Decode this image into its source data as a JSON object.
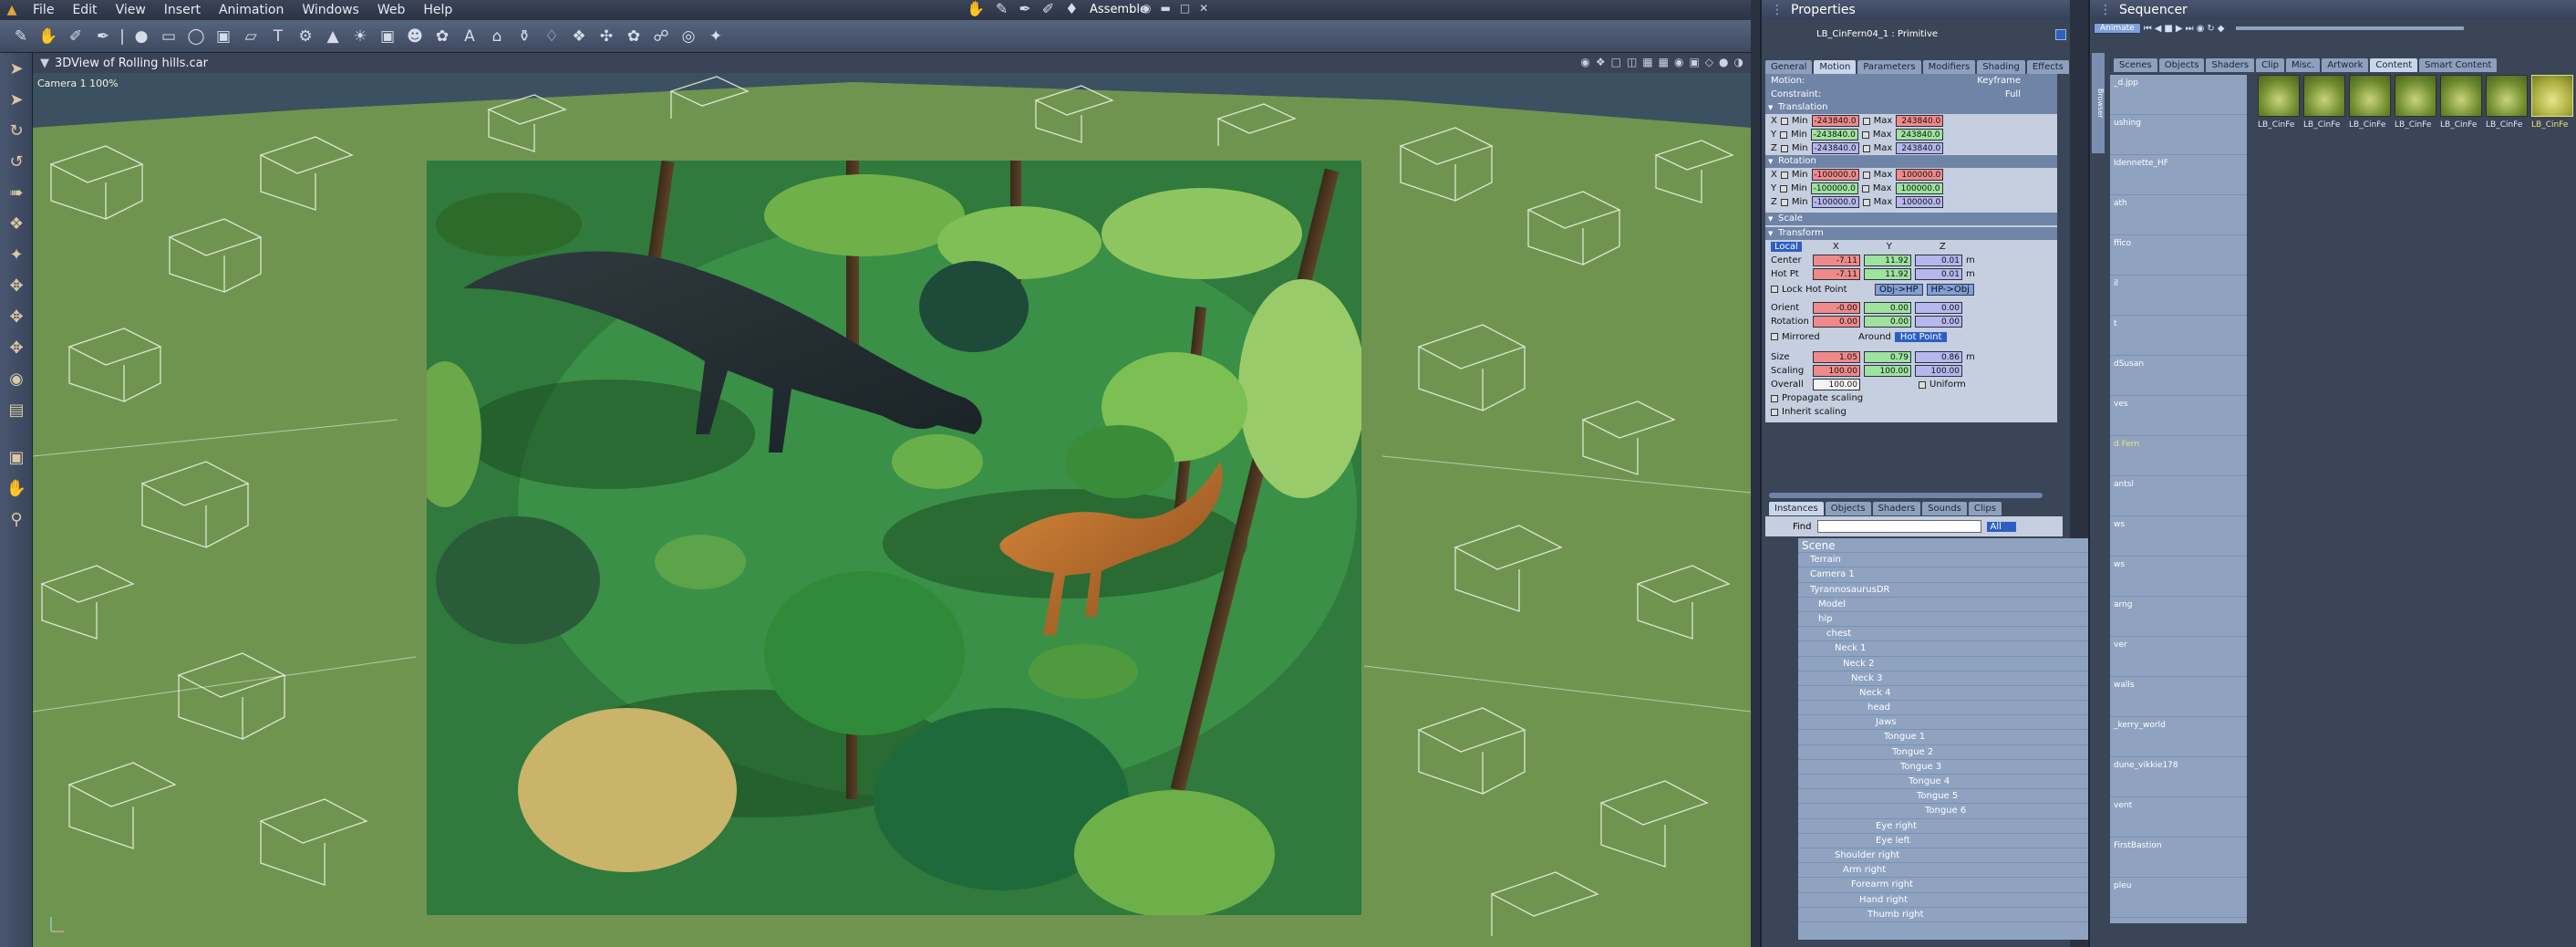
{
  "menu": {
    "items": [
      "File",
      "Edit",
      "View",
      "Insert",
      "Animation",
      "Windows",
      "Web",
      "Help"
    ],
    "workspace": "Assemble"
  },
  "viewport": {
    "title": "3DView of Rolling hills.car",
    "camera_label": "Camera 1 100%"
  },
  "properties": {
    "title": "Properties",
    "object_name": "LB_CinFern04_1 : Primitive",
    "tabs": [
      "General",
      "Motion",
      "Parameters",
      "Modifiers",
      "Shading",
      "Effects"
    ],
    "active_tab": "Motion",
    "motion_label": "Motion:",
    "motion_value": "Keyframe",
    "constraint_label": "Constraint:",
    "constraint_value": "Full",
    "translation_label": "Translation",
    "rotation_label": "Rotation",
    "scale_label": "Scale",
    "transform_label": "Transform",
    "min_label": "Min",
    "max_label": "Max",
    "translation": {
      "x_min": "-243840.0",
      "x_max": "243840.0",
      "y_min": "-243840.0",
      "y_max": "243840.0",
      "z_min": "-243840.0",
      "z_max": "243840.0"
    },
    "rotation": {
      "x_min": "-100000.0",
      "x_max": "100000.0",
      "y_min": "-100000.0",
      "y_max": "100000.0",
      "z_min": "-100000.0",
      "z_max": "100000.0"
    },
    "transform": {
      "space": "Local",
      "col_x": "X",
      "col_y": "Y",
      "col_z": "Z",
      "center_label": "Center",
      "center_x": "-7.11",
      "center_y": "11.92",
      "center_z": "0.01",
      "hotpt_label": "Hot Pt",
      "hotpt_x": "-7.11",
      "hotpt_y": "11.92",
      "hotpt_z": "0.01",
      "unit": "m",
      "lock_hot_point": "Lock Hot Point",
      "obj_hp": "Obj->HP",
      "hp_obj": "HP->Obj",
      "orient_label": "Orient",
      "orient_x": "-0.00",
      "orient_y": "0.00",
      "orient_z": "0.00",
      "rotation_label": "Rotation",
      "rotation_x": "0.00",
      "rotation_y": "0.00",
      "rotation_z": "0.00",
      "mirrored": "Mirrored",
      "around_label": "Around",
      "around_value": "Hot Point",
      "size_label": "Size",
      "size_x": "1.05",
      "size_y": "0.79",
      "size_z": "0.86",
      "scaling_label": "Scaling",
      "scaling_x": "100.00",
      "scaling_y": "100.00",
      "scaling_z": "100.00",
      "overall_label": "Overall",
      "overall_value": "100.00",
      "uniform": "Uniform",
      "propagate": "Propagate scaling",
      "inherit": "Inherit scaling"
    }
  },
  "instances": {
    "tabs": [
      "Instances",
      "Objects",
      "Shaders",
      "Sounds",
      "Clips"
    ],
    "find_label": "Find",
    "find_filter": "All",
    "tree": [
      {
        "label": "Scene",
        "depth": 0
      },
      {
        "label": "Terrain",
        "depth": 1
      },
      {
        "label": "Camera 1",
        "depth": 1
      },
      {
        "label": "TyrannosaurusDR",
        "depth": 1
      },
      {
        "label": "Model",
        "depth": 2
      },
      {
        "label": "hip",
        "depth": 2
      },
      {
        "label": "chest",
        "depth": 3
      },
      {
        "label": "Neck 1",
        "depth": 4
      },
      {
        "label": "Neck 2",
        "depth": 5
      },
      {
        "label": "Neck 3",
        "depth": 6
      },
      {
        "label": "Neck 4",
        "depth": 7
      },
      {
        "label": "head",
        "depth": 8
      },
      {
        "label": "Jaws",
        "depth": 9
      },
      {
        "label": "Tongue 1",
        "depth": 10
      },
      {
        "label": "Tongue 2",
        "depth": 11
      },
      {
        "label": "Tongue 3",
        "depth": 12
      },
      {
        "label": "Tongue 4",
        "depth": 13
      },
      {
        "label": "Tongue 5",
        "depth": 14
      },
      {
        "label": "Tongue 6",
        "depth": 15
      },
      {
        "label": "Eye right",
        "depth": 9
      },
      {
        "label": "Eye left",
        "depth": 9
      },
      {
        "label": "Shoulder right",
        "depth": 4
      },
      {
        "label": "Arm right",
        "depth": 5
      },
      {
        "label": "Forearm right",
        "depth": 6
      },
      {
        "label": "Hand right",
        "depth": 7
      },
      {
        "label": "Thumb right",
        "depth": 8
      }
    ]
  },
  "sequencer": {
    "title": "Sequencer",
    "animate": "Animate",
    "browser_label": "Browser",
    "tabs": [
      "Scenes",
      "Objects",
      "Shaders",
      "Clip",
      "Misc.",
      "Artwork",
      "Content",
      "Smart Content"
    ],
    "active_tab": "Content",
    "folders": [
      "_d.jpp",
      "ushing",
      "Idennette_HF",
      "ath",
      "ffico",
      "il",
      "t",
      "dSusan",
      "ves",
      "d Fern",
      "antsl",
      "ws",
      "ws",
      "arng",
      "ver",
      "walls",
      "_kerry_world",
      "dune_vikkie178",
      "vent",
      "FirstBastion",
      "pleu"
    ],
    "thumbs": [
      "LB_CinFe",
      "LB_CinFe",
      "LB_CinFe",
      "LB_CinFe",
      "LB_CinFe",
      "LB_CinFe",
      "LB_CinFe"
    ]
  }
}
